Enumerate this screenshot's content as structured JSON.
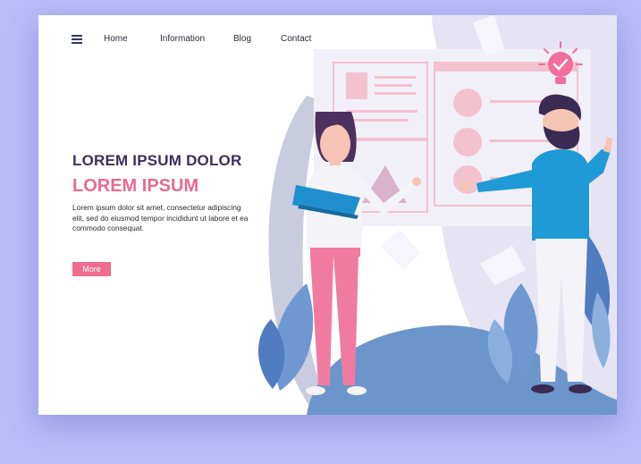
{
  "nav": {
    "items": [
      "Home",
      "Information",
      "Blog",
      "Contact"
    ]
  },
  "hero": {
    "title": "LOREM IPSUM DOLOR",
    "subtitle": "LOREM IPSUM",
    "body": "Lorem ipsum dolor sit amet, consectetur adipiscing elit, sed do eiusmod tempor incididunt ut labore et ea commodo consequat.",
    "button_label": "More"
  },
  "colors": {
    "background": "#b8bcf7",
    "title": "#3d2e5e",
    "accent_pink": "#e96a93",
    "button": "#f06d8f"
  },
  "icons": {
    "menu": "hamburger-menu-icon",
    "idea": "lightbulb-check-icon"
  }
}
